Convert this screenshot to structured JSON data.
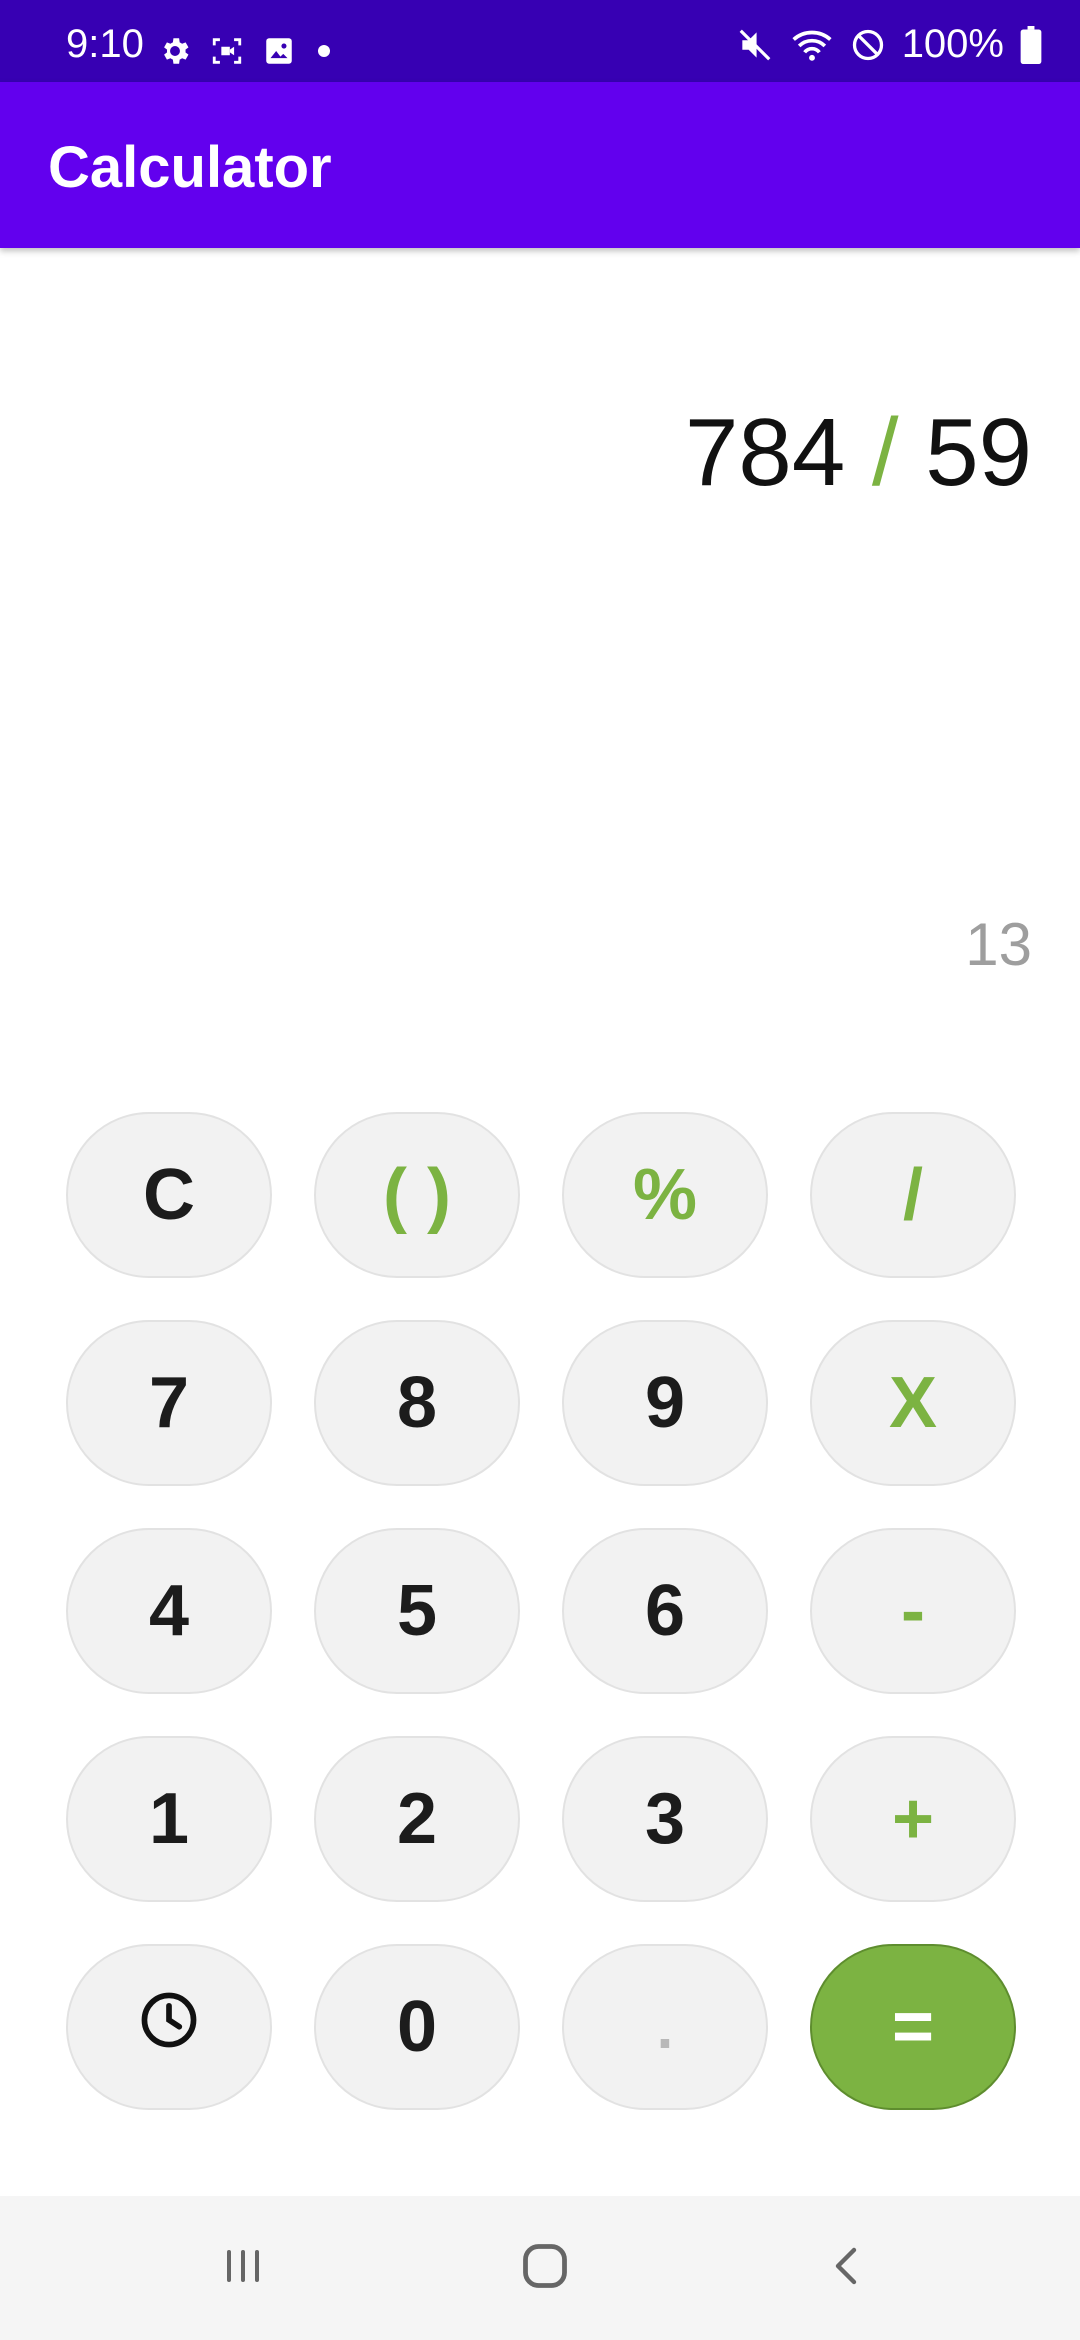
{
  "status_bar": {
    "time": "9:10",
    "left_icons": [
      "gear-icon",
      "screen-record-icon",
      "image-icon",
      "dot-icon"
    ],
    "right_icons": [
      "mute-icon",
      "wifi-icon",
      "do-not-disturb-icon",
      "battery-icon"
    ],
    "battery": "100%"
  },
  "app_bar": {
    "title": "Calculator"
  },
  "display": {
    "operand1": "784",
    "operator": "/",
    "operand2": "59",
    "result": "13"
  },
  "keypad": {
    "row1": [
      "C",
      "( )",
      "%",
      "/"
    ],
    "row2": [
      "7",
      "8",
      "9",
      "X"
    ],
    "row3": [
      "4",
      "5",
      "6",
      "-"
    ],
    "row4": [
      "1",
      "2",
      "3",
      "+"
    ],
    "row5": [
      "history-icon",
      "0",
      ".",
      "="
    ]
  },
  "colors": {
    "status_bar": "#3700b3",
    "app_bar": "#6200ee",
    "accent_green": "#7cb342",
    "key_bg": "#f2f2f2"
  },
  "nav_bar": {
    "icons": [
      "recent-apps-icon",
      "home-icon",
      "back-icon"
    ]
  }
}
